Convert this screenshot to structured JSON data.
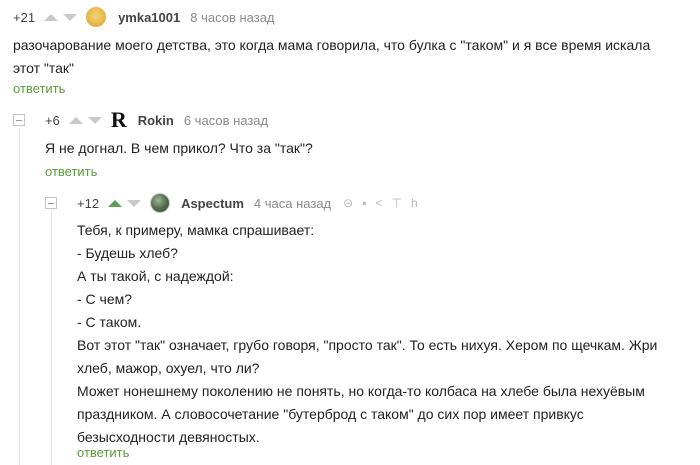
{
  "comments": [
    {
      "rating": "+21",
      "author": "ymka1001",
      "time": "8 часов назад",
      "text": [
        "разочарование моего детства, это когда мама говорила, что булка с \"таком\" и я все время искала",
        "этот \"так\""
      ],
      "reply": "ответить"
    },
    {
      "rating": "+6",
      "avatar_letter": "R",
      "author": "Rokin",
      "time": "6 часов назад",
      "text": [
        "Я не догнал. В чем прикол? Что за \"так\"?"
      ],
      "reply": "ответить"
    },
    {
      "rating": "+12",
      "author": "Aspectum",
      "time": "4 часа назад",
      "text": [
        "Тебя, к примеру, мамка спрашивает:",
        "- Будешь хлеб?",
        "А ты такой, с надеждой:",
        "- С чем?",
        "- С таком.",
        "Вот этот \"так\" означает, грубо говоря, \"просто так\". То есть нихуя. Хером по щечкам. Жри",
        "хлеб, мажор, охуел, что ли?",
        "Может нонешнему поколению не понять, но когда-то колбаса на хлебе была нехуёвым",
        "праздником. А словосочетание \"бутерброд с таком\" до сих пор имеет привкус",
        "безысходности девяностых."
      ],
      "reply": "ответить",
      "tools": [
        "link-icon",
        "save-icon",
        "share-icon",
        "pin-icon",
        "more-icon"
      ]
    }
  ],
  "colors": {
    "vote_up_active": "#5aa05a",
    "reply_link": "#5a9a3a",
    "time_text": "#8a8a8a"
  }
}
